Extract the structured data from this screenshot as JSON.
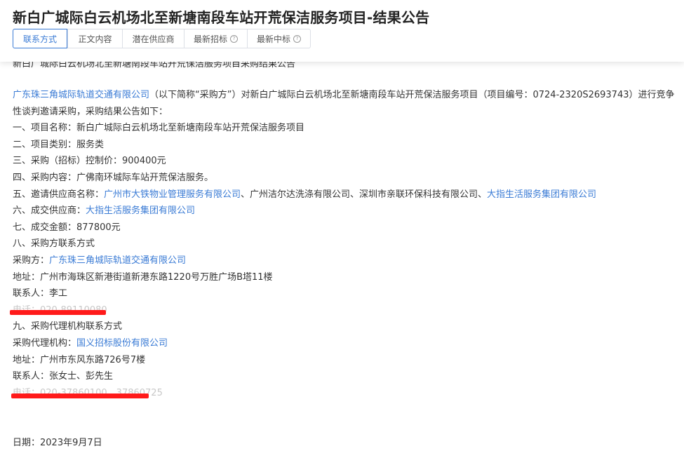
{
  "page": {
    "title": "新白广城际白云机场北至新塘南段车站开荒保洁服务项目-结果公告"
  },
  "tabs": [
    {
      "label": "联系方式",
      "active": true
    },
    {
      "label": "正文内容",
      "active": false
    },
    {
      "label": "潜在供应商",
      "active": false
    },
    {
      "label": "最新招标",
      "active": false,
      "help_icon": "question-circle-icon"
    },
    {
      "label": "最新中标",
      "active": false,
      "help_icon": "question-circle-icon"
    }
  ],
  "scrolled_partial_line": "新白广城际白云机场北至新塘南段车站开荒保洁服务项目采购结果公告",
  "intro": {
    "buyer_link": "广东珠三角城际轨道交通有限公司",
    "text": "（以下简称“采购方”）对新白广城际白云机场北至新塘南段车站开荒保洁服务项目（项目编号：0724-2320S2693743）进行竞争性谈判邀请采购，采购结果公告如下："
  },
  "items": {
    "item1": "一、项目名称：新白广城际白云机场北至新塘南段车站开荒保洁服务项目",
    "item2": "二、项目类别：服务类",
    "item3": "三、采购（招标）控制价：900400元",
    "item4": "四、采购内容：广佛南环城际车站开荒保洁服务。",
    "item5_label": "五、邀请供应商名称：",
    "item5_sup1": "广州市大铁物业管理服务有限公司",
    "item5_sep1": "、广州洁尔达洗涤有限公司、深圳市亲联环保科技有限公司、",
    "item5_sup4": "大指生活服务集团有限公司",
    "item6_label": "六、成交供应商：",
    "item6_value": "大指生活服务集团有限公司",
    "item7": "七、成交金额：877800元",
    "item8": "八、采购方联系方式",
    "buyer_label": "采购方：",
    "buyer_value": "广东珠三角城际轨道交通有限公司",
    "buyer_address": "地址：广州市海珠区新港街道新港东路1220号万胜广场B塔11楼",
    "buyer_contact": "联系人：李工",
    "buyer_phone_redacted": "电话：020-89110080",
    "item9": "九、采购代理机构联系方式",
    "agent_label": "采购代理机构：",
    "agent_value": "国义招标股份有限公司",
    "agent_address": "地址：广州市东风东路726号7楼",
    "agent_contact": "联系人：张女士、彭先生",
    "agent_phone_redacted": "电话：020-37860100、37860725",
    "date": "日期：2023年9月7日"
  },
  "colors": {
    "link": "#3a7bd5",
    "redaction": "#ff1a1a",
    "text": "#333333"
  }
}
